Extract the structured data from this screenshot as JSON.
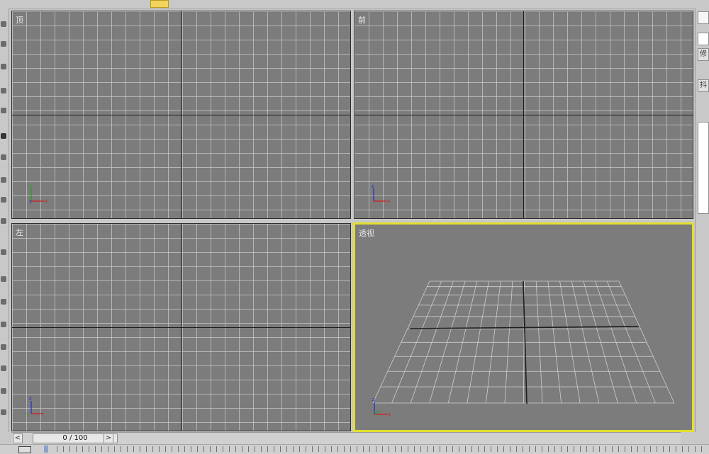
{
  "viewports": {
    "top": {
      "label": "顶"
    },
    "front": {
      "label": "前"
    },
    "left": {
      "label": "左"
    },
    "perspective": {
      "label": "透视"
    }
  },
  "axis_labels": {
    "x": "x",
    "y": "y",
    "z": "z"
  },
  "command_panel": {
    "tab_label": "修",
    "sub_label": "抖"
  },
  "time_slider": {
    "frame_text": "0 / 100",
    "prev": "<",
    "next": ">"
  },
  "colors": {
    "viewport_bg": "#7d7c7c",
    "active_border": "#e2df2f",
    "axis_x": "#d31919",
    "axis_y": "#1aa51a",
    "axis_z": "#1a2fd3"
  },
  "icons": [
    "select-tool-icon",
    "move-tool-icon",
    "rotate-tool-icon",
    "scale-tool-icon",
    "snap-icon",
    "material-editor-icon",
    "render-icon"
  ]
}
